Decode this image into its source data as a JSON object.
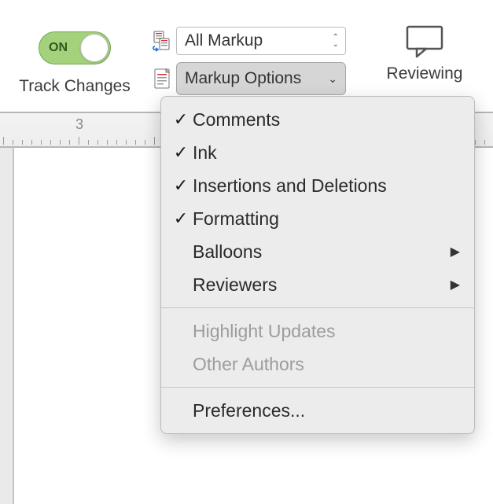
{
  "ribbon": {
    "track_changes": {
      "state_label": "ON",
      "group_label": "Track Changes"
    },
    "display_for_review": {
      "selected": "All Markup"
    },
    "markup_options_label": "Markup Options",
    "reviewing_label": "Reviewing"
  },
  "ruler": {
    "visible_number": "3"
  },
  "menu": {
    "items": [
      {
        "label": "Comments",
        "checked": true,
        "submenu": false,
        "enabled": true
      },
      {
        "label": "Ink",
        "checked": true,
        "submenu": false,
        "enabled": true
      },
      {
        "label": "Insertions and Deletions",
        "checked": true,
        "submenu": false,
        "enabled": true
      },
      {
        "label": "Formatting",
        "checked": true,
        "submenu": false,
        "enabled": true
      },
      {
        "label": "Balloons",
        "checked": false,
        "submenu": true,
        "enabled": true
      },
      {
        "label": "Reviewers",
        "checked": false,
        "submenu": true,
        "enabled": true
      }
    ],
    "disabled_items": [
      {
        "label": "Highlight Updates"
      },
      {
        "label": "Other Authors"
      }
    ],
    "preferences_label": "Preferences..."
  }
}
